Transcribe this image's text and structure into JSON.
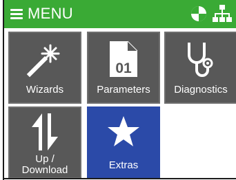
{
  "header": {
    "menu_label": "MENU",
    "background_color": "#3aaa35",
    "icons": [
      "hamburger-icon",
      "pie-chart-icon",
      "network-icon"
    ]
  },
  "tiles": [
    {
      "label": "Wizards",
      "icon": "magic-wand-icon",
      "color": "#585858"
    },
    {
      "label": "Parameters",
      "icon": "file-01-icon",
      "file_text": "01",
      "color": "#585858"
    },
    {
      "label": "Diagnostics",
      "icon": "stethoscope-icon",
      "color": "#585858"
    },
    {
      "label_line1": "Up /",
      "label_line2": "Download",
      "icon": "up-down-arrows-icon",
      "color": "#585858"
    },
    {
      "label": "Extras",
      "icon": "star-icon",
      "color": "#2b4aa8"
    }
  ]
}
